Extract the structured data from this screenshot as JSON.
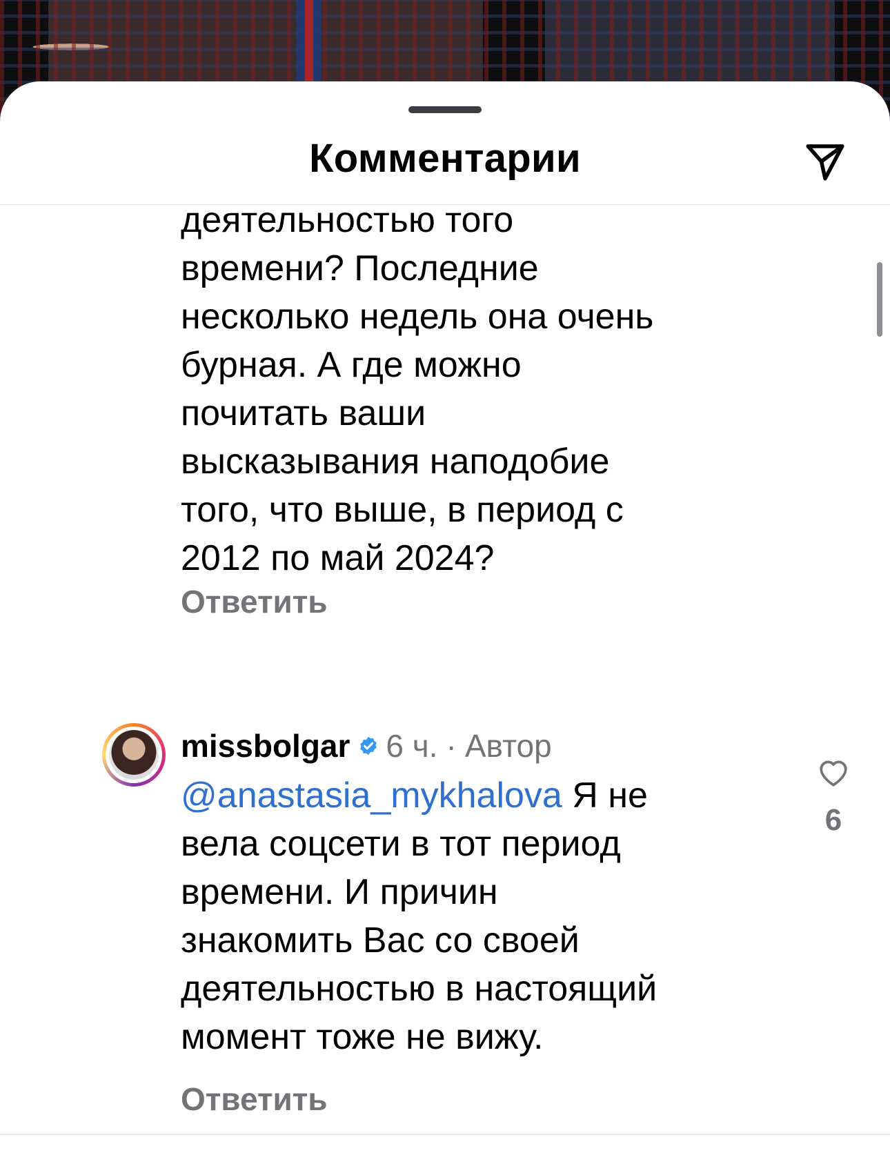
{
  "header": {
    "title": "Комментарии",
    "share_icon": "send-icon"
  },
  "comment_prev": {
    "text": "деятельностью того\nвремени? Последние\nнесколько недель она очень\nбурная. А где можно\nпочитать ваши\nвысказывания наподобие\nтого, что выше,  в период с\n2012 по май 2024?",
    "reply_label": "Ответить"
  },
  "comment_reply": {
    "username": "missbolgar",
    "verified_icon": "verified-badge-icon",
    "time": "6 ч.",
    "separator": "·",
    "author_tag": "Автор",
    "mention": "@anastasia_mykhalova",
    "text_after_mention": " Я не\nвела соцсети в тот период\nвремени. И причин\nзнакомить Вас со своей\nдеятельностью в настоящий\nмомент тоже не вижу.",
    "reply_label": "Ответить",
    "like_icon": "heart-outline-icon",
    "like_count": "6"
  },
  "colors": {
    "accent_link": "#2f6fcf",
    "secondary_text": "#737378",
    "verified": "#3897f0"
  }
}
